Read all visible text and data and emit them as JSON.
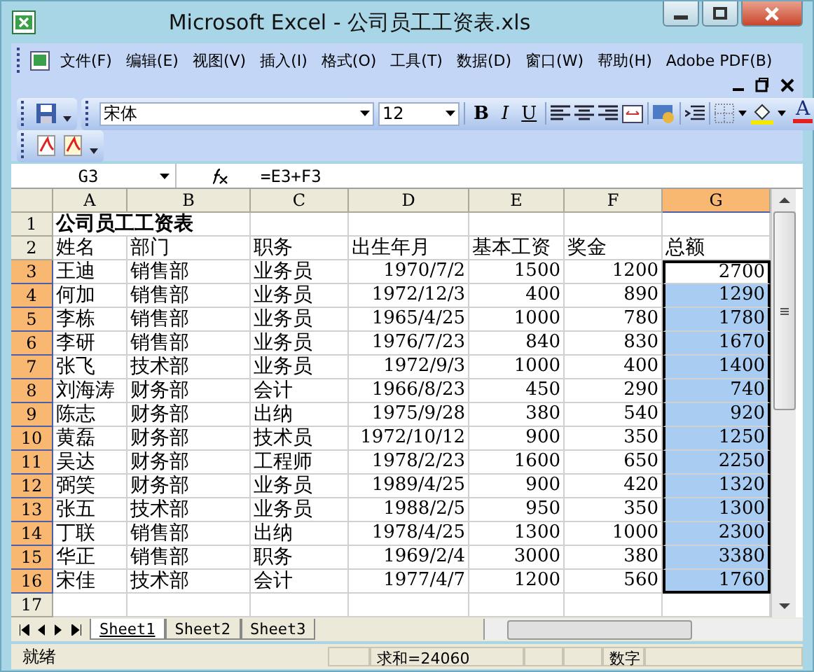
{
  "window": {
    "title": "Microsoft Excel - 公司员工工资表.xls"
  },
  "menu": [
    "文件(F)",
    "编辑(E)",
    "视图(V)",
    "插入(I)",
    "格式(O)",
    "工具(T)",
    "数据(D)",
    "窗口(W)",
    "帮助(H)",
    "Adobe PDF(B)"
  ],
  "formatting_toolbar": {
    "font": "宋体",
    "size": "12",
    "style_buttons": [
      "B",
      "I",
      "U"
    ],
    "font_color_button": "A"
  },
  "formula_bar": {
    "name_box": "G3",
    "formula": "=E3+F3"
  },
  "columns": [
    {
      "label": "A",
      "selected": false,
      "numeric": false
    },
    {
      "label": "B",
      "selected": false,
      "numeric": false
    },
    {
      "label": "C",
      "selected": false,
      "numeric": false
    },
    {
      "label": "D",
      "selected": false,
      "numeric": true
    },
    {
      "label": "E",
      "selected": false,
      "numeric": true
    },
    {
      "label": "F",
      "selected": false,
      "numeric": true
    },
    {
      "label": "G",
      "selected": true,
      "numeric": true
    }
  ],
  "rows": [
    {
      "label": "1",
      "kind": "title",
      "selected": false,
      "cells": [
        "公司员工工资表"
      ]
    },
    {
      "label": "2",
      "kind": "header",
      "selected": false,
      "cells": [
        "姓名",
        "部门",
        "职务",
        "出生年月",
        "基本工资",
        "奖金",
        "总额"
      ]
    },
    {
      "label": "3",
      "kind": "data",
      "selected": true,
      "active": true,
      "cells": [
        "王迪",
        "销售部",
        "业务员",
        "1970/7/2",
        "1500",
        "1200",
        "2700"
      ]
    },
    {
      "label": "4",
      "kind": "data",
      "selected": true,
      "active": false,
      "cells": [
        "何加",
        "销售部",
        "业务员",
        "1972/12/3",
        "400",
        "890",
        "1290"
      ]
    },
    {
      "label": "5",
      "kind": "data",
      "selected": true,
      "active": false,
      "cells": [
        "李栋",
        "销售部",
        "业务员",
        "1965/4/25",
        "1000",
        "780",
        "1780"
      ]
    },
    {
      "label": "6",
      "kind": "data",
      "selected": true,
      "active": false,
      "cells": [
        "李研",
        "销售部",
        "业务员",
        "1976/7/23",
        "840",
        "830",
        "1670"
      ]
    },
    {
      "label": "7",
      "kind": "data",
      "selected": true,
      "active": false,
      "cells": [
        "张飞",
        "技术部",
        "业务员",
        "1972/9/3",
        "1000",
        "400",
        "1400"
      ]
    },
    {
      "label": "8",
      "kind": "data",
      "selected": true,
      "active": false,
      "cells": [
        "刘海涛",
        "财务部",
        "会计",
        "1966/8/23",
        "450",
        "290",
        "740"
      ]
    },
    {
      "label": "9",
      "kind": "data",
      "selected": true,
      "active": false,
      "cells": [
        "陈志",
        "财务部",
        "出纳",
        "1975/9/28",
        "380",
        "540",
        "920"
      ]
    },
    {
      "label": "10",
      "kind": "data",
      "selected": true,
      "active": false,
      "cells": [
        "黄磊",
        "财务部",
        "技术员",
        "1972/10/12",
        "900",
        "350",
        "1250"
      ]
    },
    {
      "label": "11",
      "kind": "data",
      "selected": true,
      "active": false,
      "cells": [
        "吴达",
        "财务部",
        "工程师",
        "1978/2/23",
        "1600",
        "650",
        "2250"
      ]
    },
    {
      "label": "12",
      "kind": "data",
      "selected": true,
      "active": false,
      "cells": [
        "弼笑",
        "财务部",
        "业务员",
        "1989/4/25",
        "900",
        "420",
        "1320"
      ]
    },
    {
      "label": "13",
      "kind": "data",
      "selected": true,
      "active": false,
      "cells": [
        "张五",
        "技术部",
        "业务员",
        "1988/2/5",
        "950",
        "350",
        "1300"
      ]
    },
    {
      "label": "14",
      "kind": "data",
      "selected": true,
      "active": false,
      "cells": [
        "丁联",
        "销售部",
        "出纳",
        "1978/4/25",
        "1300",
        "1000",
        "2300"
      ]
    },
    {
      "label": "15",
      "kind": "data",
      "selected": true,
      "active": false,
      "cells": [
        "华正",
        "销售部",
        "职务",
        "1969/2/4",
        "3000",
        "380",
        "3380"
      ]
    },
    {
      "label": "16",
      "kind": "data",
      "selected": true,
      "active": false,
      "cells": [
        "宋佳",
        "技术部",
        "会计",
        "1977/4/7",
        "1200",
        "560",
        "1760"
      ]
    },
    {
      "label": "17",
      "kind": "data",
      "selected": false,
      "cells": []
    }
  ],
  "sheet_tabs": [
    {
      "label": "Sheet1",
      "selected": true
    },
    {
      "label": "Sheet2",
      "selected": false
    },
    {
      "label": "Sheet3",
      "selected": false
    }
  ],
  "status_bar": {
    "state": "就绪",
    "sum": "求和=24060",
    "mode": "数字"
  }
}
